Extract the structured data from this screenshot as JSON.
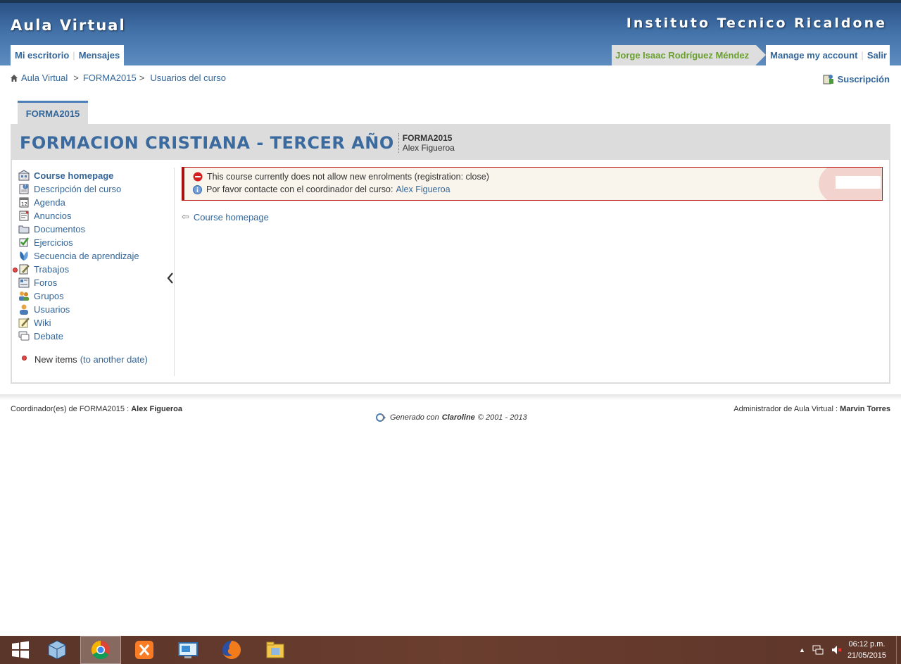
{
  "header": {
    "site_title": "Aula Virtual",
    "institution": "Instituto Tecnico Ricaldone",
    "nav_left": [
      "Mi escritorio",
      "Mensajes"
    ],
    "user_name": "Jorge Isaac Rodríguez Méndez",
    "manage_account": "Manage my account",
    "logout": "Salir"
  },
  "breadcrumb": {
    "items": [
      "Aula Virtual",
      "FORMA2015",
      "Usuarios del curso"
    ],
    "separator": ">"
  },
  "subscription": "Suscripción",
  "course": {
    "tab_label": "FORMA2015",
    "title": "FORMACION CRISTIANA - TERCER AÑO",
    "code": "FORMA2015",
    "teacher": "Alex Figueroa"
  },
  "tools": [
    {
      "label": "Course homepage",
      "icon": "course-home-icon"
    },
    {
      "label": "Descripción del curso",
      "icon": "description-icon"
    },
    {
      "label": "Agenda",
      "icon": "calendar-icon"
    },
    {
      "label": "Anuncios",
      "icon": "announcements-icon"
    },
    {
      "label": "Documentos",
      "icon": "folder-icon"
    },
    {
      "label": "Ejercicios",
      "icon": "checkmark-icon"
    },
    {
      "label": "Secuencia de aprendizaje",
      "icon": "learning-path-icon"
    },
    {
      "label": "Trabajos",
      "icon": "assignments-icon"
    },
    {
      "label": "Foros",
      "icon": "forums-icon"
    },
    {
      "label": "Grupos",
      "icon": "groups-icon"
    },
    {
      "label": "Usuarios",
      "icon": "user-icon"
    },
    {
      "label": "Wiki",
      "icon": "wiki-icon"
    },
    {
      "label": "Debate",
      "icon": "chat-icon"
    }
  ],
  "new_items": {
    "label": "New items",
    "link": "(to another date)"
  },
  "messages": {
    "error": "This course currently does not allow new enrolments (registration: close)",
    "info_prefix": "Por favor contacte con el coordinador del curso:",
    "info_link": "Alex Figueroa"
  },
  "back_link": "Course homepage",
  "footer": {
    "left_prefix": "Coordinador(es) de FORMA2015 :",
    "left_name": "Alex Figueroa",
    "right_prefix": "Administrador de Aula Virtual :",
    "right_name": "Marvin Torres",
    "generated_prefix": "Generado con",
    "generated_product": "Claroline",
    "generated_suffix": "© 2001 - 2013"
  },
  "taskbar": {
    "time": "06:12 p.m.",
    "date": "21/05/2015"
  },
  "colors": {
    "header_blue": "#4271a8",
    "link_blue": "#33669a",
    "user_green": "#6a9f2e",
    "error_red": "#aa1111"
  }
}
